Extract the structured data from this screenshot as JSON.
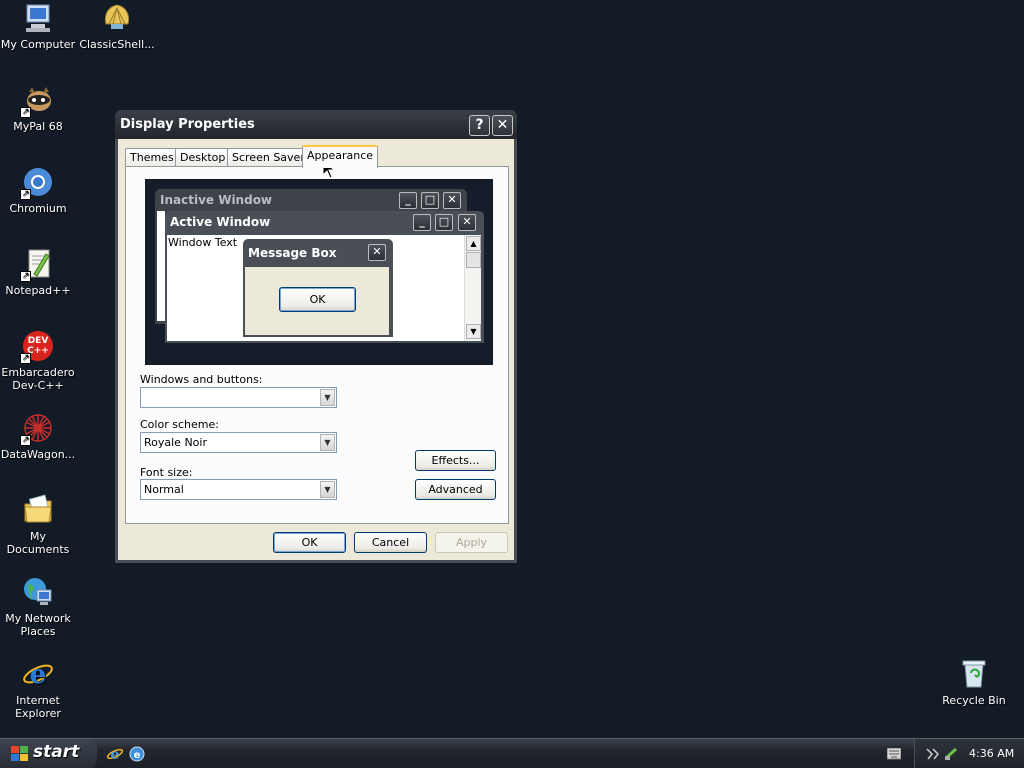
{
  "desktop": {
    "icons": [
      {
        "label": "My Computer",
        "icon": "my-computer-icon"
      },
      {
        "label": "ClassicShell...",
        "icon": "classic-shell-icon"
      },
      {
        "label": "MyPal 68",
        "icon": "mypal-icon"
      },
      {
        "label": "Chromium",
        "icon": "chromium-icon"
      },
      {
        "label": "Notepad++",
        "icon": "notepad-plus-plus-icon"
      },
      {
        "label": "Embarcadero Dev-C++",
        "icon": "dev-cpp-icon",
        "badge": "DEV C++"
      },
      {
        "label": "DataWagon...",
        "icon": "datawagon-icon"
      },
      {
        "label": "My Documents",
        "icon": "my-documents-icon"
      },
      {
        "label": "My Network Places",
        "icon": "network-places-icon"
      },
      {
        "label": "Internet Explorer",
        "icon": "internet-explorer-icon"
      },
      {
        "label": "Recycle Bin",
        "icon": "recycle-bin-icon"
      }
    ]
  },
  "window": {
    "title": "Display Properties",
    "help_glyph": "?",
    "close_glyph": "✕",
    "tabs": [
      {
        "label": "Themes"
      },
      {
        "label": "Desktop"
      },
      {
        "label": "Screen Saver"
      },
      {
        "label": "Appearance",
        "active": true
      }
    ],
    "preview": {
      "inactive_title": "Inactive Window",
      "active_title": "Active Window",
      "window_text": "Window Text",
      "message_box_title": "Message Box",
      "message_box_ok": "OK"
    },
    "windows_and_buttons": {
      "label": "Windows and buttons:",
      "value": ""
    },
    "color_scheme": {
      "label": "Color scheme:",
      "value": "Royale Noir"
    },
    "font_size": {
      "label": "Font size:",
      "value": "Normal"
    },
    "effects_button": "Effects...",
    "advanced_button": "Advanced",
    "ok_button": "OK",
    "cancel_button": "Cancel",
    "apply_button": "Apply"
  },
  "taskbar": {
    "start_label": "start",
    "clock": "4:36 AM"
  },
  "colors": {
    "desktop": "#131b27",
    "title_bar": "#2a2e35",
    "dialog_face": "#ece9d8",
    "tab_highlight": "#ffc83c"
  }
}
